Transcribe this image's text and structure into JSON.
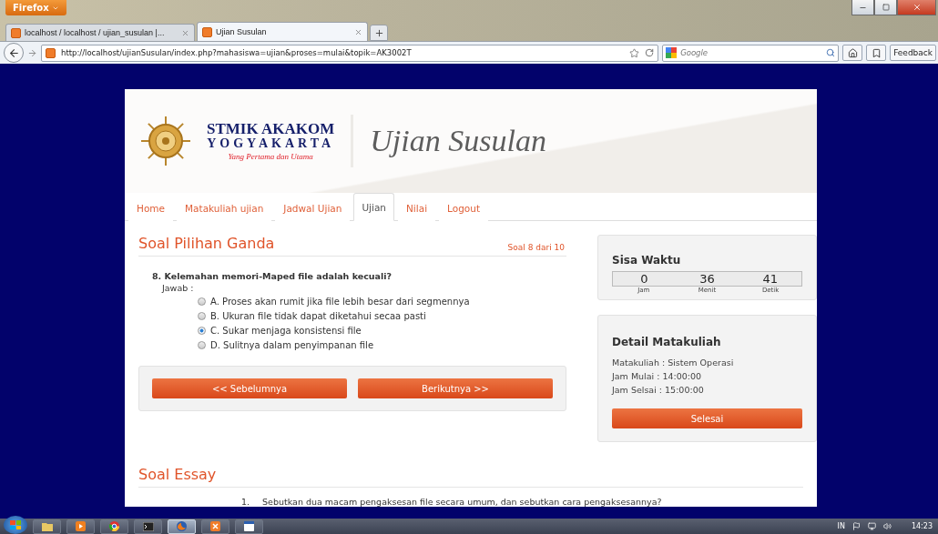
{
  "browser": {
    "menu_button": "Firefox",
    "tabs": [
      {
        "title": "localhost / localhost / ujian_susulan |...",
        "selected": false
      },
      {
        "title": "Ujian Susulan",
        "selected": true
      }
    ],
    "url": "http://localhost/ujianSusulan/index.php?mahasiswa=ujian&proses=mulai&topik=AK3002T",
    "search_placeholder": "Google",
    "feedback": "Feedback"
  },
  "header": {
    "brand_line_1": "STMIK AKAKOM",
    "brand_line_2": "YOGYAKARTA",
    "tagline": "Yang Pertama dan Utama",
    "title": "Ujian Susulan"
  },
  "nav": [
    {
      "label": "Home",
      "selected": false
    },
    {
      "label": "Matakuliah ujian",
      "selected": false
    },
    {
      "label": "Jadwal Ujian",
      "selected": false
    },
    {
      "label": "Ujian",
      "selected": true
    },
    {
      "label": "Nilai",
      "selected": false
    },
    {
      "label": "Logout",
      "selected": false
    }
  ],
  "quiz": {
    "title": "Soal Pilihan Ganda",
    "counter": "Soal 8 dari 10",
    "question": "8. Kelemahan memori-Maped file adalah kecuali?",
    "answer_label": "Jawab :",
    "options": [
      {
        "label": "A. Proses akan rumit jika file lebih besar dari segmennya",
        "selected": false
      },
      {
        "label": "B. Ukuran file tidak dapat diketahui secaa pasti",
        "selected": false
      },
      {
        "label": "C. Sukar menjaga konsistensi file",
        "selected": true
      },
      {
        "label": "D. Sulitnya dalam penyimpanan file",
        "selected": false
      }
    ],
    "buttons": [
      "<< Sebelumnya",
      "Berikutnya >>"
    ]
  },
  "timer": {
    "title": "Sisa Waktu",
    "units": [
      {
        "value": "0",
        "label": "Jam"
      },
      {
        "value": "36",
        "label": "Menit"
      },
      {
        "value": "41",
        "label": "Detik"
      }
    ]
  },
  "detail": {
    "title": "Detail Matakuliah",
    "lines": [
      "Matakuliah : Sistem Operasi",
      "Jam Mulai : 14:00:00",
      "Jam Selsai : 15:00:00"
    ],
    "button": "Selesai"
  },
  "essay": {
    "title": "Soal Essay",
    "questions": [
      {
        "number": "1.",
        "text": "Sebutkan dua macam pengaksesan file secara umum, dan sebutkan cara pengaksesannya?"
      }
    ]
  },
  "taskbar": {
    "apps": [
      {
        "kind": "folder",
        "active": false
      },
      {
        "kind": "media",
        "active": false
      },
      {
        "kind": "chrome",
        "active": false
      },
      {
        "kind": "terminal",
        "active": false
      },
      {
        "kind": "firefox",
        "active": true
      },
      {
        "kind": "xampp",
        "active": false
      },
      {
        "kind": "word",
        "active": false
      }
    ],
    "language": "IN",
    "time": "14:23"
  }
}
